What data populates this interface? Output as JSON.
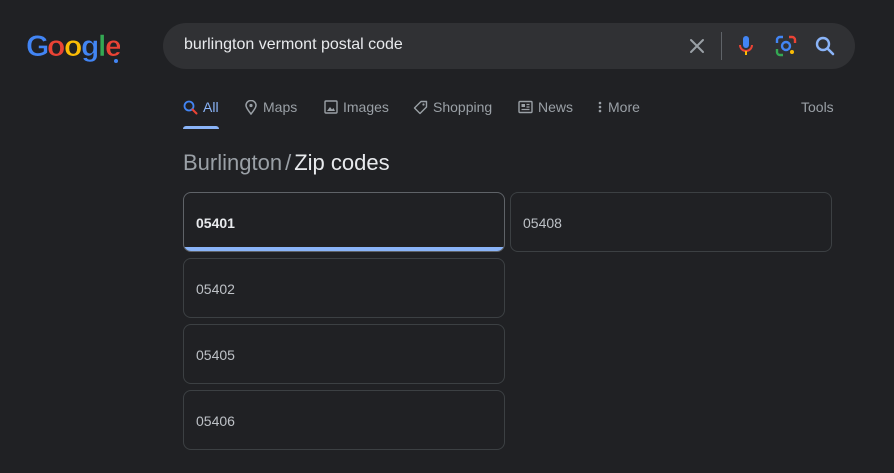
{
  "logo": {
    "text": "Google"
  },
  "search": {
    "query": "burlington vermont postal code"
  },
  "tabs": [
    {
      "label": "All",
      "icon": "search-icon",
      "active": true
    },
    {
      "label": "Maps",
      "icon": "map-pin-icon"
    },
    {
      "label": "Images",
      "icon": "image-icon"
    },
    {
      "label": "Shopping",
      "icon": "tag-icon"
    },
    {
      "label": "News",
      "icon": "newspaper-icon"
    },
    {
      "label": "More",
      "icon": "more-vertical-icon"
    }
  ],
  "tools_label": "Tools",
  "breadcrumb": {
    "parent": "Burlington",
    "separator": "/",
    "current": "Zip codes"
  },
  "zip_codes": [
    {
      "code": "05401",
      "selected": true
    },
    {
      "code": "05402"
    },
    {
      "code": "05405"
    },
    {
      "code": "05406"
    },
    {
      "code": "05408"
    }
  ],
  "colors": {
    "background": "#202124",
    "search_bar": "#303134",
    "accent": "#8ab4f8"
  }
}
